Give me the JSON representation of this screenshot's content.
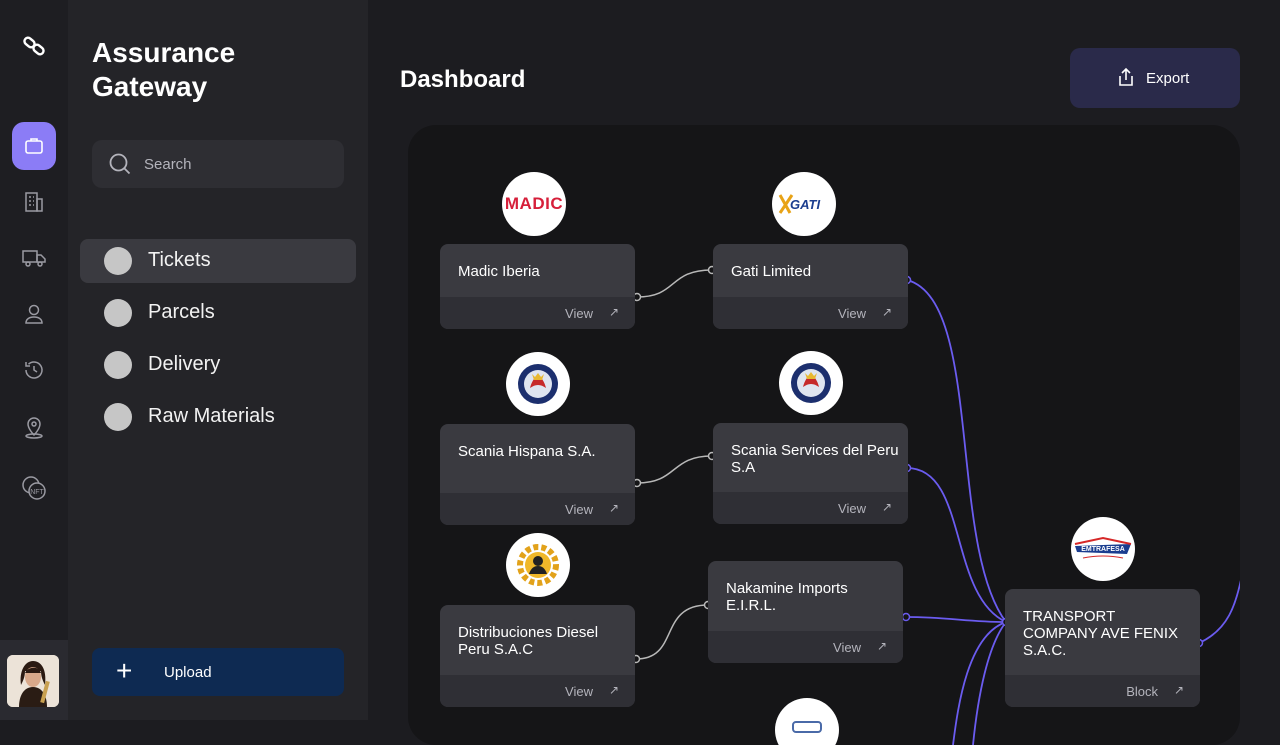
{
  "brand": {
    "title": "Assurance Gateway"
  },
  "search": {
    "placeholder": "Search"
  },
  "menu": [
    {
      "label": "Tickets",
      "active": true
    },
    {
      "label": "Parcels",
      "active": false
    },
    {
      "label": "Delivery",
      "active": false
    },
    {
      "label": "Raw Materials",
      "active": false
    }
  ],
  "rail_icons": [
    "link-icon",
    "briefcase-icon",
    "building-icon",
    "truck-icon",
    "user-icon",
    "history-icon",
    "location-pin-icon",
    "coins-icon"
  ],
  "upload": {
    "label": "Upload"
  },
  "header": {
    "title": "Dashboard",
    "export_label": "Export"
  },
  "nodes": [
    {
      "name": "Madic Iberia",
      "action": "View",
      "logo": "MADIC"
    },
    {
      "name": "Gati Limited",
      "action": "View",
      "logo": "GATI"
    },
    {
      "name": "Scania Hispana S.A.",
      "action": "View",
      "logo": "scania-logo"
    },
    {
      "name": "Scania Services del Peru S.A",
      "action": "View",
      "logo": "scania-logo"
    },
    {
      "name": "Distribuciones Diesel Peru S.A.C",
      "action": "View",
      "logo": "gear-worker-logo"
    },
    {
      "name": "Nakamine Imports E.I.R.L.",
      "action": "View",
      "logo": ""
    },
    {
      "name": "TRANSPORT COMPANY AVE FENIX S.A.C.",
      "action": "Block",
      "logo": "EMTRAFESA"
    }
  ],
  "colors": {
    "accent": "#8b7cf6",
    "link_primary": "#6b5cf0",
    "link_secondary": "#b8b8b8",
    "upload_bg": "#0e2a52"
  }
}
